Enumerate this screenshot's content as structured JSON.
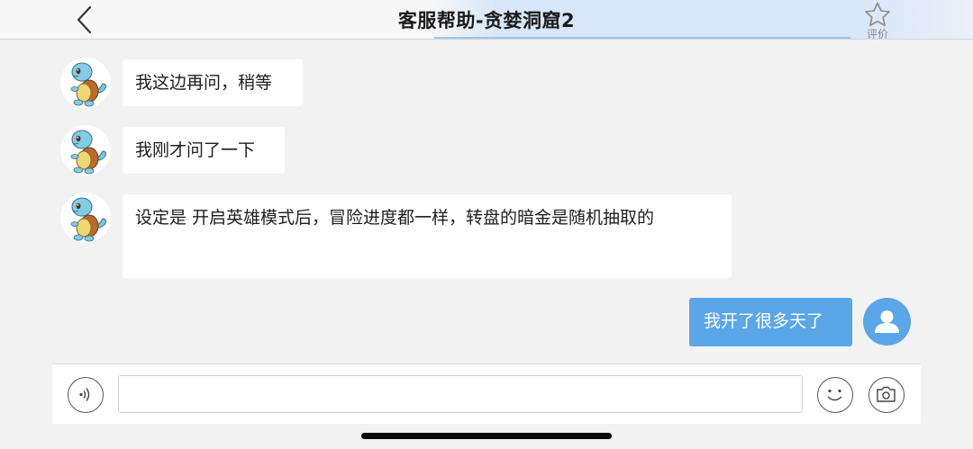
{
  "header": {
    "title": "客服帮助-贪婪洞窟2",
    "rate_label": "评价"
  },
  "messages": [
    {
      "side": "left",
      "text": "我这边再问，稍等"
    },
    {
      "side": "left",
      "text": "我刚才问了一下"
    },
    {
      "side": "left",
      "text": "设定是 开启英雄模式后，冒险进度都一样，转盘的暗金是随机抽取的"
    },
    {
      "side": "right",
      "text": "我开了很多天了"
    }
  ],
  "input": {
    "value": "",
    "placeholder": ""
  },
  "icons": {
    "back": "chevron-left-icon",
    "rate": "star-outline-icon",
    "voice": "voice-icon",
    "emoji": "smiley-icon",
    "camera": "camera-icon",
    "user": "user-icon",
    "support_avatar": "squirtle-avatar"
  },
  "colors": {
    "accent": "#5aa6e6",
    "bubble_left": "#ffffff",
    "background": "#f2f2f2"
  }
}
